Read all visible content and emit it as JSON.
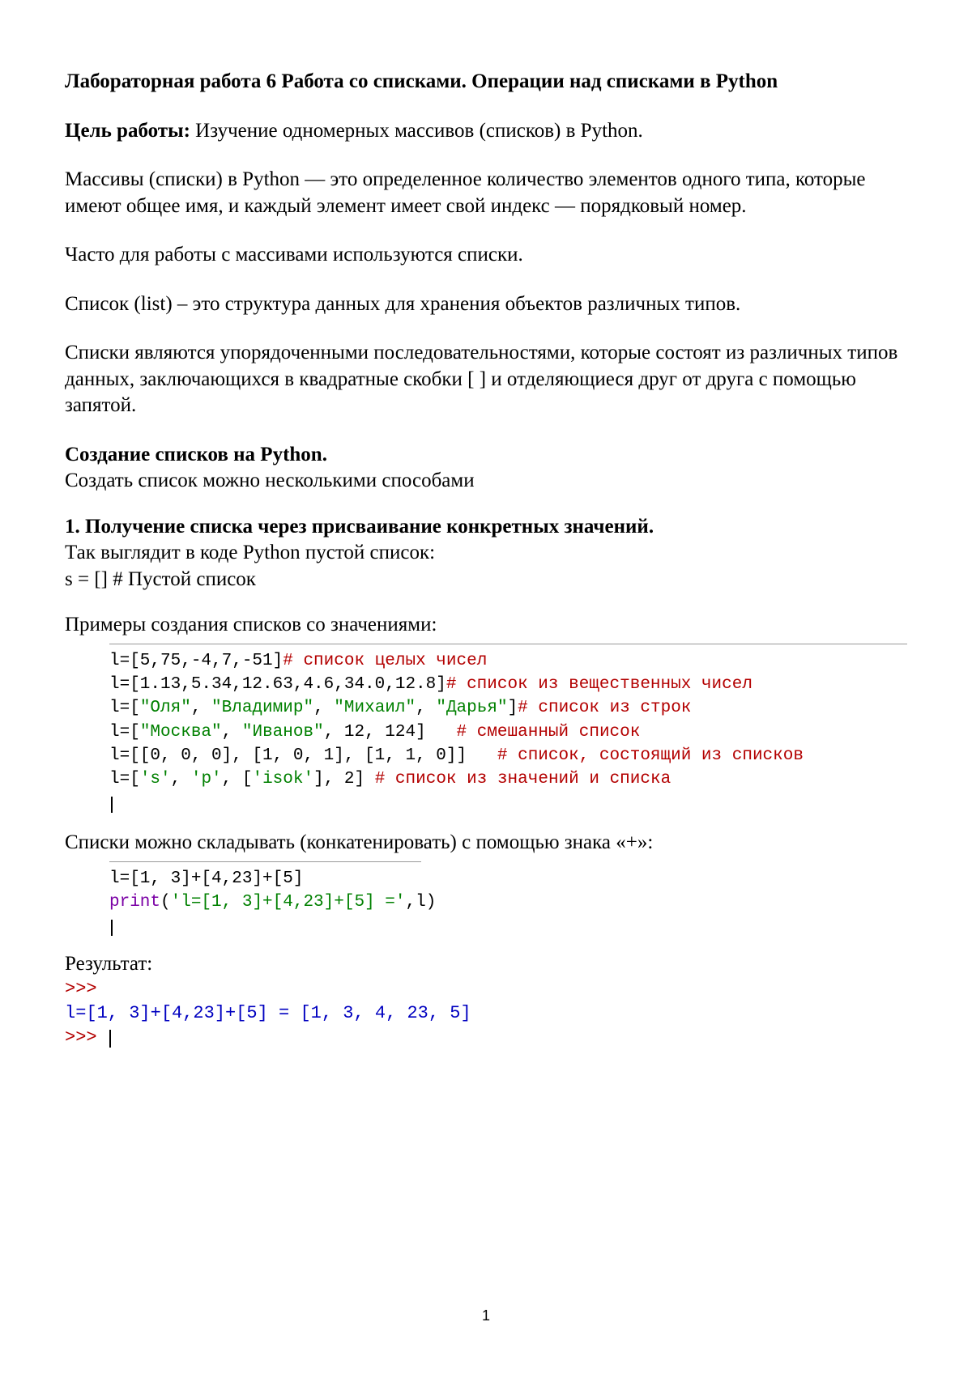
{
  "title": "Лабораторная работа 6 Работа со списками. Операции над списками в Python",
  "goal_label": "Цель работы:",
  "goal_text": " Изучение одномерных массивов (списков) в Python.",
  "p1": "Массивы (списки) в Python — это определенное количество элементов одного типа, которые имеют общее имя, и каждый элемент имеет свой индекс — порядковый номер.",
  "p2": "Часто для работы с массивами используются списки.",
  "p3": "Список (list) – это структура данных для хранения объектов различных типов.",
  "p4": "Списки являются упорядоченными последовательностями, которые состоят из различных типов данных, заключающихся в квадратные скобки [ ] и отделяющиеся друг от друга с помощью запятой.",
  "h2": "Создание списков на Python.",
  "h2_after": "Создать список можно несколькими способами",
  "h3": "1. Получение списка через присваивание конкретных значений.",
  "h3_after1": "Так выглядит в коде Python пустой список:",
  "h3_after2": "s = []  # Пустой список",
  "p5": "Примеры создания списков со значениями:",
  "code1": {
    "l1a": "l=[5,75,-4,7,-51]",
    "l1b": "# список целых чисел",
    "l2a": "l=[1.13,5.34,12.63,4.6,34.0,12.8]",
    "l2b": "# список из вещественных чисел",
    "l3a": "l=[",
    "l3s1": "\"Оля\"",
    "l3c1": ", ",
    "l3s2": "\"Владимир\"",
    "l3c2": ", ",
    "l3s3": "\"Михаил\"",
    "l3c3": ", ",
    "l3s4": "\"Дарья\"",
    "l3e": "]",
    "l3b": "# список из строк",
    "l4a": "l=[",
    "l4s1": "\"Москва\"",
    "l4c1": ", ",
    "l4s2": "\"Иванов\"",
    "l4e": ", 12, 124]   ",
    "l4b": "# смешанный список",
    "l5a": "l=[[0, 0, 0], [1, 0, 1], [1, 1, 0]]   ",
    "l5b": "# список, состоящий из списков",
    "l6a": "l=[",
    "l6s1": "'s'",
    "l6c1": ", ",
    "l6s2": "'p'",
    "l6c2": ", [",
    "l6s3": "'isok'",
    "l6e": "], 2] ",
    "l6b": "# список из значений и списка"
  },
  "p6": "Списки можно складывать (конкатенировать) с помощью знака «+»:",
  "code2": {
    "l1": "l=[1, 3]+[4,23]+[5]",
    "l2a": "print",
    "l2b": "(",
    "l2s": "'l=[1, 3]+[4,23]+[5] ='",
    "l2e": ",l)"
  },
  "resultLabel": "Результат:",
  "result": {
    "l1": ">>> ",
    "l2": "l=[1, 3]+[4,23]+[5] = [1, 3, 4, 23, 5]",
    "l3": ">>> "
  },
  "pageNumber": "1"
}
